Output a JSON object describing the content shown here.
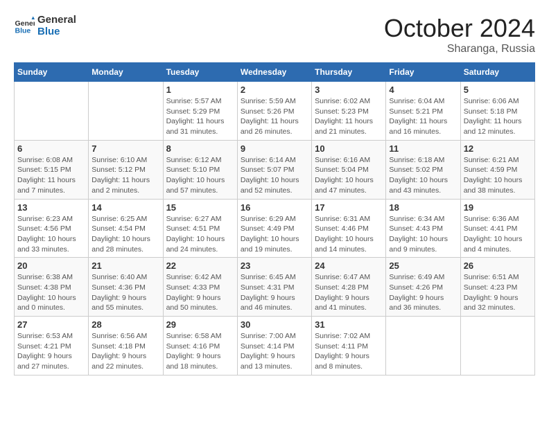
{
  "logo": {
    "line1": "General",
    "line2": "Blue"
  },
  "title": "October 2024",
  "location": "Sharanga, Russia",
  "weekdays": [
    "Sunday",
    "Monday",
    "Tuesday",
    "Wednesday",
    "Thursday",
    "Friday",
    "Saturday"
  ],
  "weeks": [
    [
      {
        "day": "",
        "info": ""
      },
      {
        "day": "",
        "info": ""
      },
      {
        "day": "1",
        "info": "Sunrise: 5:57 AM\nSunset: 5:29 PM\nDaylight: 11 hours and 31 minutes."
      },
      {
        "day": "2",
        "info": "Sunrise: 5:59 AM\nSunset: 5:26 PM\nDaylight: 11 hours and 26 minutes."
      },
      {
        "day": "3",
        "info": "Sunrise: 6:02 AM\nSunset: 5:23 PM\nDaylight: 11 hours and 21 minutes."
      },
      {
        "day": "4",
        "info": "Sunrise: 6:04 AM\nSunset: 5:21 PM\nDaylight: 11 hours and 16 minutes."
      },
      {
        "day": "5",
        "info": "Sunrise: 6:06 AM\nSunset: 5:18 PM\nDaylight: 11 hours and 12 minutes."
      }
    ],
    [
      {
        "day": "6",
        "info": "Sunrise: 6:08 AM\nSunset: 5:15 PM\nDaylight: 11 hours and 7 minutes."
      },
      {
        "day": "7",
        "info": "Sunrise: 6:10 AM\nSunset: 5:12 PM\nDaylight: 11 hours and 2 minutes."
      },
      {
        "day": "8",
        "info": "Sunrise: 6:12 AM\nSunset: 5:10 PM\nDaylight: 10 hours and 57 minutes."
      },
      {
        "day": "9",
        "info": "Sunrise: 6:14 AM\nSunset: 5:07 PM\nDaylight: 10 hours and 52 minutes."
      },
      {
        "day": "10",
        "info": "Sunrise: 6:16 AM\nSunset: 5:04 PM\nDaylight: 10 hours and 47 minutes."
      },
      {
        "day": "11",
        "info": "Sunrise: 6:18 AM\nSunset: 5:02 PM\nDaylight: 10 hours and 43 minutes."
      },
      {
        "day": "12",
        "info": "Sunrise: 6:21 AM\nSunset: 4:59 PM\nDaylight: 10 hours and 38 minutes."
      }
    ],
    [
      {
        "day": "13",
        "info": "Sunrise: 6:23 AM\nSunset: 4:56 PM\nDaylight: 10 hours and 33 minutes."
      },
      {
        "day": "14",
        "info": "Sunrise: 6:25 AM\nSunset: 4:54 PM\nDaylight: 10 hours and 28 minutes."
      },
      {
        "day": "15",
        "info": "Sunrise: 6:27 AM\nSunset: 4:51 PM\nDaylight: 10 hours and 24 minutes."
      },
      {
        "day": "16",
        "info": "Sunrise: 6:29 AM\nSunset: 4:49 PM\nDaylight: 10 hours and 19 minutes."
      },
      {
        "day": "17",
        "info": "Sunrise: 6:31 AM\nSunset: 4:46 PM\nDaylight: 10 hours and 14 minutes."
      },
      {
        "day": "18",
        "info": "Sunrise: 6:34 AM\nSunset: 4:43 PM\nDaylight: 10 hours and 9 minutes."
      },
      {
        "day": "19",
        "info": "Sunrise: 6:36 AM\nSunset: 4:41 PM\nDaylight: 10 hours and 4 minutes."
      }
    ],
    [
      {
        "day": "20",
        "info": "Sunrise: 6:38 AM\nSunset: 4:38 PM\nDaylight: 10 hours and 0 minutes."
      },
      {
        "day": "21",
        "info": "Sunrise: 6:40 AM\nSunset: 4:36 PM\nDaylight: 9 hours and 55 minutes."
      },
      {
        "day": "22",
        "info": "Sunrise: 6:42 AM\nSunset: 4:33 PM\nDaylight: 9 hours and 50 minutes."
      },
      {
        "day": "23",
        "info": "Sunrise: 6:45 AM\nSunset: 4:31 PM\nDaylight: 9 hours and 46 minutes."
      },
      {
        "day": "24",
        "info": "Sunrise: 6:47 AM\nSunset: 4:28 PM\nDaylight: 9 hours and 41 minutes."
      },
      {
        "day": "25",
        "info": "Sunrise: 6:49 AM\nSunset: 4:26 PM\nDaylight: 9 hours and 36 minutes."
      },
      {
        "day": "26",
        "info": "Sunrise: 6:51 AM\nSunset: 4:23 PM\nDaylight: 9 hours and 32 minutes."
      }
    ],
    [
      {
        "day": "27",
        "info": "Sunrise: 6:53 AM\nSunset: 4:21 PM\nDaylight: 9 hours and 27 minutes."
      },
      {
        "day": "28",
        "info": "Sunrise: 6:56 AM\nSunset: 4:18 PM\nDaylight: 9 hours and 22 minutes."
      },
      {
        "day": "29",
        "info": "Sunrise: 6:58 AM\nSunset: 4:16 PM\nDaylight: 9 hours and 18 minutes."
      },
      {
        "day": "30",
        "info": "Sunrise: 7:00 AM\nSunset: 4:14 PM\nDaylight: 9 hours and 13 minutes."
      },
      {
        "day": "31",
        "info": "Sunrise: 7:02 AM\nSunset: 4:11 PM\nDaylight: 9 hours and 8 minutes."
      },
      {
        "day": "",
        "info": ""
      },
      {
        "day": "",
        "info": ""
      }
    ]
  ]
}
